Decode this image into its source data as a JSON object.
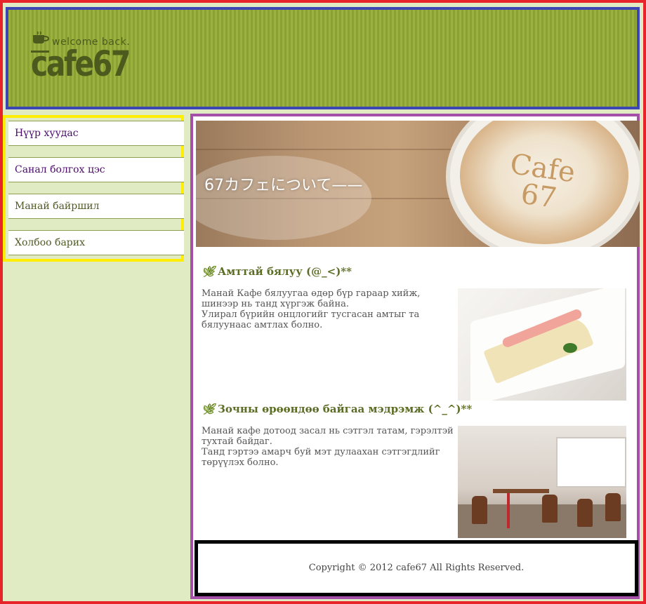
{
  "header": {
    "tagline": "welcome back.",
    "logo_text": "cafe67"
  },
  "sidebar": {
    "items": [
      {
        "label": "Нүүр хуудас",
        "state": "visited"
      },
      {
        "label": "Санал болгох цэс",
        "state": "visited"
      },
      {
        "label": "Манай байршил",
        "state": "default"
      },
      {
        "label": "Холбоо барих",
        "state": "default"
      }
    ]
  },
  "main": {
    "hero": {
      "title": "67カフェについて——",
      "latte_art": "Cafe 67"
    },
    "sections": [
      {
        "title": "Амттай бялуу (@_<)**",
        "body_lines": [
          "Манай Кафе бялуугаа өдөр бүр гараар хийж, шинээр нь танд хүргэж байна.",
          "Улирал бүрийн онцлогийг тусгасан амтыг та бялуунаас амтлах болно."
        ],
        "image": "cake-photo"
      },
      {
        "title": "Зочны өрөөндөө байгаа мэдрэмж (^_^)**",
        "body_lines": [
          "Манай кафе дотоод засал нь сэтгэл татам, гэрэлтэй тухтай байдаг.",
          "Танд гэртээ амарч буй мэт дулаахан сэтгэгдлийг төрүүлэх болно."
        ],
        "image": "cafe-interior-photo"
      }
    ]
  },
  "footer": {
    "copyright": "Copyright © 2012 cafe67 All Rights Reserved."
  },
  "colors": {
    "page_border": "#e8242b",
    "header_border": "#3d47b3",
    "header_bg": "#97ad3c",
    "sidebar_border": "#ffee00",
    "main_border": "#a44fa8",
    "footer_border": "#000000",
    "page_bg": "#e0ebc4",
    "heading_green": "#5c6e25"
  }
}
